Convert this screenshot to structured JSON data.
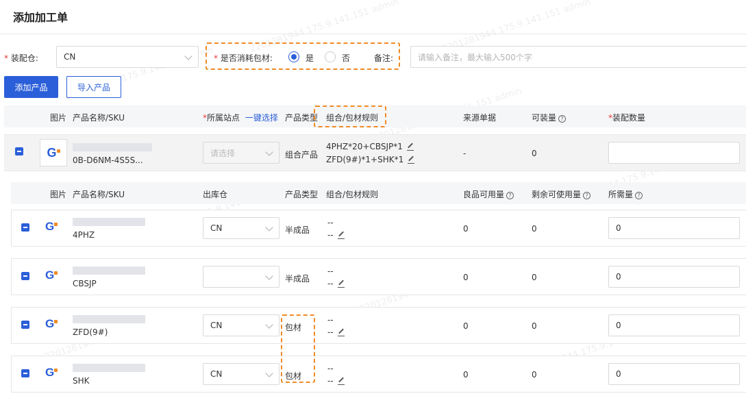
{
  "page": {
    "title": "添加加工单"
  },
  "form": {
    "assembly_warehouse": {
      "label": "装配仓:",
      "value": "CN"
    },
    "consume_packaging": {
      "label": "是否消耗包材:",
      "options": [
        "是",
        "否"
      ],
      "selected": "是"
    },
    "remark": {
      "label": "备注:",
      "placeholder": "请输入备注，最大输入500个字"
    }
  },
  "toolbar": {
    "add_product": "添加产品",
    "import_product": "导入产品"
  },
  "table": {
    "headers": {
      "image": "图片",
      "name_sku": "产品名称/SKU",
      "site": "*所属站点",
      "site_req": "*",
      "site_text": "所属站点",
      "one_click": "一键选择",
      "product_type": "产品类型",
      "combo_rule": "组合/包材规则",
      "source_doc": "来源单据",
      "available": "可装量",
      "assemble_qty_req": "*",
      "assemble_qty": "装配数量"
    },
    "parent": {
      "sku": "0B-D6NM-4S5S...",
      "site_placeholder": "请选择",
      "type": "组合产品",
      "rule_line1": "4PHZ*20+CBSJP*1",
      "rule_line2": "ZFD(9#)*1+SHK*1",
      "source": "-",
      "available": "0",
      "assemble_qty": ""
    },
    "child_headers": {
      "image": "图片",
      "name_sku": "产品名称/SKU",
      "warehouse": "出库仓",
      "product_type": "产品类型",
      "combo_rule": "组合/包材规则",
      "good_available": "良品可用量",
      "remaining": "剩余可使用量",
      "required": "所需量"
    },
    "children": [
      {
        "sku": "4PHZ",
        "warehouse": "CN",
        "type": "半成品",
        "rule1": "--",
        "rule2": "--",
        "good": "0",
        "remaining": "0",
        "required": "0"
      },
      {
        "sku": "CBSJP",
        "warehouse": "",
        "type": "半成品",
        "rule1": "--",
        "rule2": "--",
        "good": "0",
        "remaining": "0",
        "required": "0"
      },
      {
        "sku": "ZFD(9#)",
        "warehouse": "CN",
        "type": "包材",
        "rule1": "--",
        "rule2": "--",
        "good": "0",
        "remaining": "0",
        "required": "0"
      },
      {
        "sku": "SHK",
        "warehouse": "CN",
        "type": "包材",
        "rule1": "--",
        "rule2": "--",
        "good": "0",
        "remaining": "0",
        "required": "0"
      }
    ]
  },
  "watermark": "2201281944 175.9.141.151 admin",
  "colors": {
    "primary": "#2b5fd9",
    "highlight": "#f08a24",
    "required": "#e53935"
  }
}
